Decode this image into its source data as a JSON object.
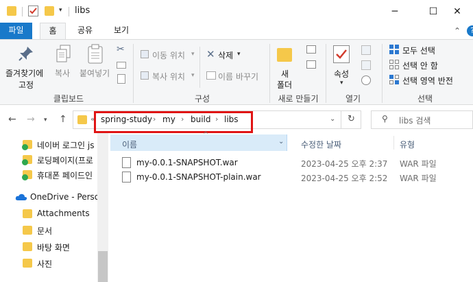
{
  "window": {
    "title": "libs",
    "minimize": "─",
    "maximize": "☐",
    "close": "✕"
  },
  "ribbon_tabs": [
    "파일",
    "홈",
    "공유",
    "보기"
  ],
  "ribbon": {
    "clipboard": {
      "pin_line1": "즐겨찾기에",
      "pin_line2": "고정",
      "copy": "복사",
      "paste": "붙여넣기",
      "group": "클립보드"
    },
    "organize": {
      "move_to": "이동 위치",
      "copy_to": "복사 위치",
      "delete": "삭제",
      "rename": "이름 바꾸기",
      "group": "구성"
    },
    "new": {
      "new_folder_line1": "새",
      "new_folder_line2": "폴더",
      "group": "새로 만들기"
    },
    "open": {
      "properties": "속성",
      "group": "열기"
    },
    "select": {
      "select_all": "모두 선택",
      "select_none": "선택 안 함",
      "invert": "선택 영역 반전",
      "group": "선택"
    }
  },
  "address": {
    "overflow": "«",
    "breadcrumbs": [
      "spring-study",
      "my",
      "build",
      "libs"
    ],
    "search_placeholder": "libs 검색"
  },
  "nav_pane": {
    "items": [
      "네이버 로그인 js",
      "로딩페이지(프로",
      "휴대폰 페이드인",
      "OneDrive - Person",
      "Attachments",
      "문서",
      "바탕 화면",
      "사진"
    ]
  },
  "columns": {
    "name": "이름",
    "modified": "수정한 날짜",
    "type": "유형"
  },
  "files": [
    {
      "name": "my-0.0.1-SNAPSHOT.war",
      "modified": "2023-04-25 오후 2:37",
      "type": "WAR 파일"
    },
    {
      "name": "my-0.0.1-SNAPSHOT-plain.war",
      "modified": "2023-04-25 오후 2:52",
      "type": "WAR 파일"
    }
  ],
  "colors": {
    "file_tab": "#1979ca",
    "highlight_box": "#e01414",
    "header_selected": "#d9ebf9",
    "folder": "#f5c84a",
    "onedrive": "#1a73d9",
    "check_badge": "#2fa84f"
  }
}
